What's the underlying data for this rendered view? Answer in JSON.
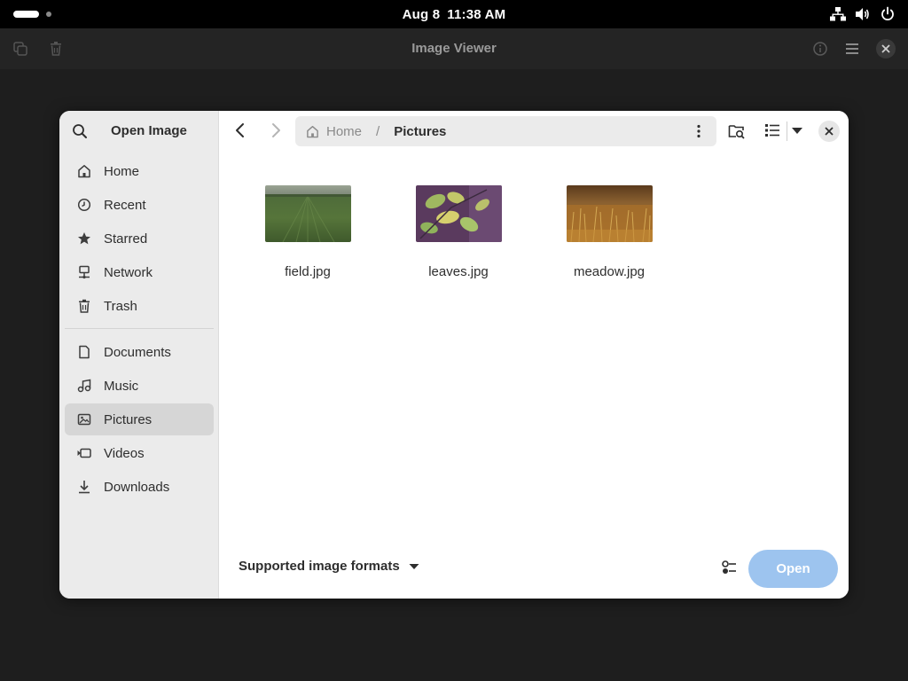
{
  "topbar": {
    "date": "Aug 8",
    "time": "11:38 AM",
    "icons": [
      "network-icon",
      "volume-icon",
      "power-icon"
    ]
  },
  "viewer": {
    "title": "Image Viewer",
    "left_icons": [
      "copy-icon",
      "trash-icon"
    ],
    "right_icons": [
      "info-icon",
      "menu-icon",
      "close-icon"
    ]
  },
  "dialog": {
    "title": "Open Image",
    "sidebar": {
      "places": [
        {
          "label": "Home",
          "icon": "home-icon"
        },
        {
          "label": "Recent",
          "icon": "clock-icon"
        },
        {
          "label": "Starred",
          "icon": "star-icon"
        },
        {
          "label": "Network",
          "icon": "network-icon"
        },
        {
          "label": "Trash",
          "icon": "trash-icon"
        }
      ],
      "bookmarks": [
        {
          "label": "Documents",
          "icon": "document-icon"
        },
        {
          "label": "Music",
          "icon": "music-icon"
        },
        {
          "label": "Pictures",
          "icon": "pictures-icon",
          "active": true
        },
        {
          "label": "Videos",
          "icon": "video-icon"
        },
        {
          "label": "Downloads",
          "icon": "download-icon"
        }
      ]
    },
    "path": {
      "home": "Home",
      "separator": "/",
      "current": "Pictures"
    },
    "files": [
      {
        "name": "field.jpg"
      },
      {
        "name": "leaves.jpg"
      },
      {
        "name": "meadow.jpg"
      }
    ],
    "filter_label": "Supported image formats",
    "open_label": "Open",
    "colors": {
      "accent_disabled": "#9dc4ef",
      "sidebar_bg": "#ebebeb",
      "active_item_bg": "#d6d6d6"
    }
  }
}
